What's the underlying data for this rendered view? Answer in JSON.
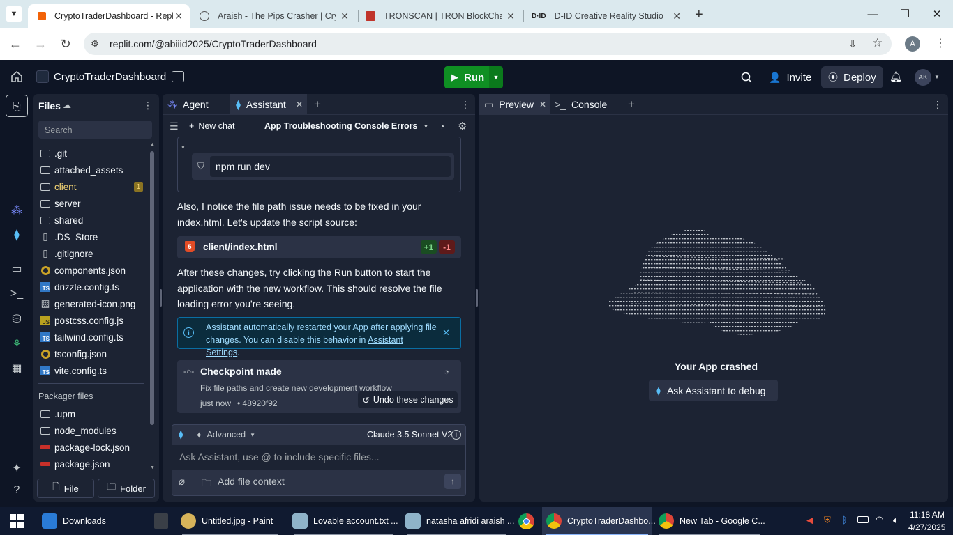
{
  "browser": {
    "tabs": [
      {
        "title": "CryptoTraderDashboard - Replit",
        "active": true
      },
      {
        "title": "Araish - The Pips Crasher | Cryp",
        "active": false
      },
      {
        "title": "TRONSCAN | TRON BlockChain",
        "active": false
      },
      {
        "title": "D-ID Creative Reality Studio",
        "active": false
      }
    ],
    "url": "replit.com/@abiiid2025/CryptoTraderDashboard",
    "profile_initial": "A"
  },
  "header": {
    "project_name": "CryptoTraderDashboard",
    "run_label": "Run",
    "invite_label": "Invite",
    "deploy_label": "Deploy",
    "avatar_initials": "AK"
  },
  "files": {
    "title": "Files",
    "search_placeholder": "Search",
    "items": [
      {
        "name": ".git",
        "type": "folder"
      },
      {
        "name": "attached_assets",
        "type": "folder"
      },
      {
        "name": "client",
        "type": "folder",
        "badge": "1"
      },
      {
        "name": "server",
        "type": "folder"
      },
      {
        "name": "shared",
        "type": "folder"
      },
      {
        "name": ".DS_Store",
        "type": "file"
      },
      {
        "name": ".gitignore",
        "type": "file"
      },
      {
        "name": "components.json",
        "type": "json"
      },
      {
        "name": "drizzle.config.ts",
        "type": "ts"
      },
      {
        "name": "generated-icon.png",
        "type": "image"
      },
      {
        "name": "postcss.config.js",
        "type": "js"
      },
      {
        "name": "tailwind.config.ts",
        "type": "ts"
      },
      {
        "name": "tsconfig.json",
        "type": "json"
      },
      {
        "name": "vite.config.ts",
        "type": "ts"
      }
    ],
    "packager_title": "Packager files",
    "packager_items": [
      {
        "name": ".upm",
        "type": "folder"
      },
      {
        "name": "node_modules",
        "type": "folder"
      },
      {
        "name": "package-lock.json",
        "type": "npm"
      },
      {
        "name": "package.json",
        "type": "npm"
      }
    ],
    "new_file_label": "File",
    "new_folder_label": "Folder"
  },
  "agent_panel": {
    "tabs": [
      {
        "label": "Agent"
      },
      {
        "label": "Assistant"
      }
    ],
    "new_chat_label": "New chat",
    "chat_title": "App Troubleshooting Console Errors",
    "command": "npm run dev",
    "message1": "Also, I notice the file path issue needs to be fixed in your index.html. Let's update the script source:",
    "file_change": {
      "path": "client/index.html",
      "added": "+1",
      "removed": "-1"
    },
    "message2": "After these changes, try clicking the Run button to start the application with the new workflow. This should resolve the file loading error you're seeing.",
    "info_text": "Assistant automatically restarted your App after applying file changes. You can disable this behavior in",
    "info_link": "Assistant Settings",
    "info_suffix": ".",
    "checkpoint": {
      "title": "Checkpoint made",
      "description": "Fix file paths and create new development workflow",
      "time": "just now",
      "hash": "• 48920f92",
      "undo_label": "Undo these changes"
    },
    "mode_label": "Advanced",
    "model_label": "Claude 3.5 Sonnet V2",
    "input_placeholder": "Ask Assistant, use @ to include specific files...",
    "add_context_label": "Add file context"
  },
  "preview_panel": {
    "tabs": [
      {
        "label": "Preview"
      },
      {
        "label": "Console"
      }
    ],
    "crash_text": "Your App crashed",
    "debug_label": "Ask Assistant to debug"
  },
  "taskbar": {
    "items": [
      {
        "label": "Downloads"
      },
      {
        "label": "Untitled.jpg - Paint"
      },
      {
        "label": "Lovable account.txt ..."
      },
      {
        "label": "natasha afridi araish ..."
      },
      {
        "label": "CryptoTraderDashbo..."
      },
      {
        "label": "New Tab - Google C..."
      }
    ],
    "time": "11:18 AM",
    "date": "4/27/2025"
  },
  "colors": {
    "background": "#0e1525",
    "panel": "#1c2333",
    "run_green": "#0f8f23",
    "info_border": "#0a6ea3",
    "link_blue": "#58bdf6"
  }
}
